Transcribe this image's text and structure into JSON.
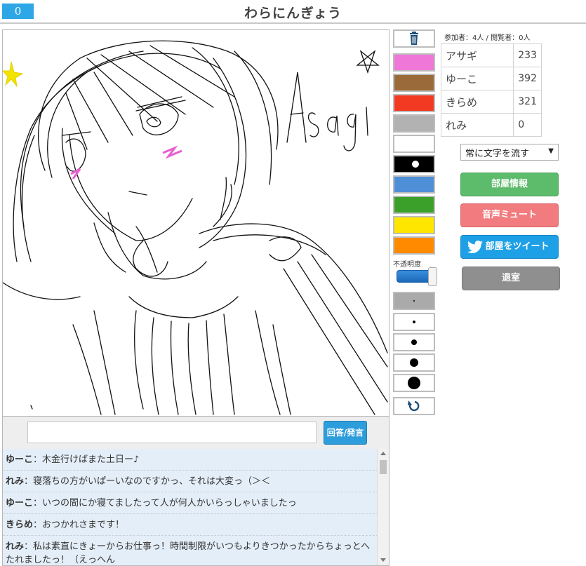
{
  "header": {
    "timer": "0",
    "title": "わらにんぎょう"
  },
  "canvas": {
    "signature_text": "Asagi"
  },
  "answer": {
    "placeholder": "",
    "button_label": "回答/発言"
  },
  "chat": {
    "messages": [
      {
        "name": "ゆーこ",
        "text": "：木金行けばまた土日ー♪"
      },
      {
        "name": "れみ",
        "text": "：寝落ちの方がいぱーいなのですかっ、それは大変っ（＞＜"
      },
      {
        "name": "ゆーこ",
        "text": "：いつの間にか寝てましたって人が何人かいらっしゃいましたっ"
      },
      {
        "name": "きらめ",
        "text": "：おつかれさまです！"
      },
      {
        "name": "れみ",
        "text": "：私は素直にきょーからお仕事っ！時間制限がいつもよりきつかったからちょっとへたれましたっ！（えっへん"
      }
    ]
  },
  "palette": {
    "icons": {
      "clear": "trash-icon",
      "undo": "undo-icon"
    },
    "colors": [
      "#ee77d8",
      "#9b6a3a",
      "#f23a22",
      "#b2b2b2",
      "#ffffff",
      "#000000",
      "#4f8fd8",
      "#3aa02a",
      "#ffe600",
      "#ff8a00"
    ],
    "selected_color": "#000000",
    "opacity_label": "不透明度",
    "pen_sizes": [
      2,
      4,
      8,
      12,
      18
    ],
    "selected_size_index": 0
  },
  "room": {
    "participants_text": "参加者：4人 / 閲覧者：0人",
    "players": [
      {
        "name": "アサギ",
        "score": "233"
      },
      {
        "name": "ゆーこ",
        "score": "392"
      },
      {
        "name": "きらめ",
        "score": "321"
      },
      {
        "name": "れみ",
        "score": "0"
      }
    ],
    "mode_select": "常に文字を流す",
    "buttons": {
      "info": "部屋情報",
      "mute": "音声ミュート",
      "tweet": "部屋をツイート",
      "leave": "退室"
    }
  }
}
